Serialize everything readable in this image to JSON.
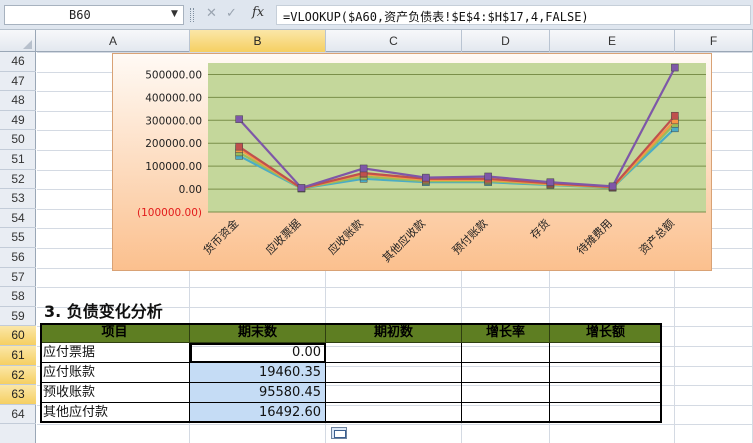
{
  "formula_bar": {
    "name_box": "B60",
    "fx": "fx",
    "formula": "=VLOOKUP($A60,资产负债表!$E$4:$H$17,4,FALSE)"
  },
  "columns": [
    "A",
    "B",
    "C",
    "D",
    "E",
    "F"
  ],
  "selected_column": "B",
  "rows": [
    "46",
    "47",
    "48",
    "49",
    "50",
    "51",
    "52",
    "53",
    "54",
    "55",
    "56",
    "57",
    "58",
    "59",
    "60",
    "61",
    "62",
    "63",
    "64"
  ],
  "selected_rows": [
    "60",
    "61",
    "62",
    "63"
  ],
  "chart_data": {
    "type": "line",
    "categories": [
      "货币资金",
      "应收票据",
      "应收账款",
      "其他应收款",
      "预付账款",
      "存货",
      "待摊费用",
      "资产总额"
    ],
    "y_ticks": [
      "500000.00",
      "400000.00",
      "300000.00",
      "200000.00",
      "100000.00",
      "0.00",
      "(100000.00)"
    ],
    "ylim": [
      -100000,
      550000
    ],
    "grid": true,
    "series": [
      {
        "color": "#7e57a8",
        "values": [
          305000,
          5000,
          90000,
          50000,
          55000,
          30000,
          12000,
          530000
        ]
      },
      {
        "color": "#c0504d",
        "values": [
          185000,
          4000,
          70000,
          45000,
          45000,
          25000,
          9000,
          320000
        ]
      },
      {
        "color": "#f79646",
        "values": [
          175000,
          3500,
          65000,
          40000,
          40000,
          22000,
          8000,
          300000
        ]
      },
      {
        "color": "#9bbb59",
        "values": [
          160000,
          3000,
          55000,
          35000,
          35000,
          20000,
          7000,
          285000
        ]
      },
      {
        "color": "#4bacc6",
        "values": [
          145000,
          2500,
          45000,
          30000,
          30000,
          18000,
          6000,
          265000
        ]
      }
    ],
    "colors": {
      "plot_bg": "#c4d79b",
      "grid": "#7a8f4a",
      "negative_tick": "#e21b1b"
    }
  },
  "section": {
    "title": "3. 负债变化分析",
    "headers": [
      "项目",
      "期末数",
      "期初数",
      "增长率",
      "增长额"
    ],
    "rows": [
      {
        "item": "应付票据",
        "end": "0.00"
      },
      {
        "item": "应付账款",
        "end": "19460.35"
      },
      {
        "item": "预收账款",
        "end": "95580.45"
      },
      {
        "item": "其他应付款",
        "end": "16492.60"
      }
    ]
  },
  "colors": {
    "header_green": "#5e7e22",
    "selected_blue": "#c5dcf5",
    "selection_gold": "#f5cf62"
  }
}
